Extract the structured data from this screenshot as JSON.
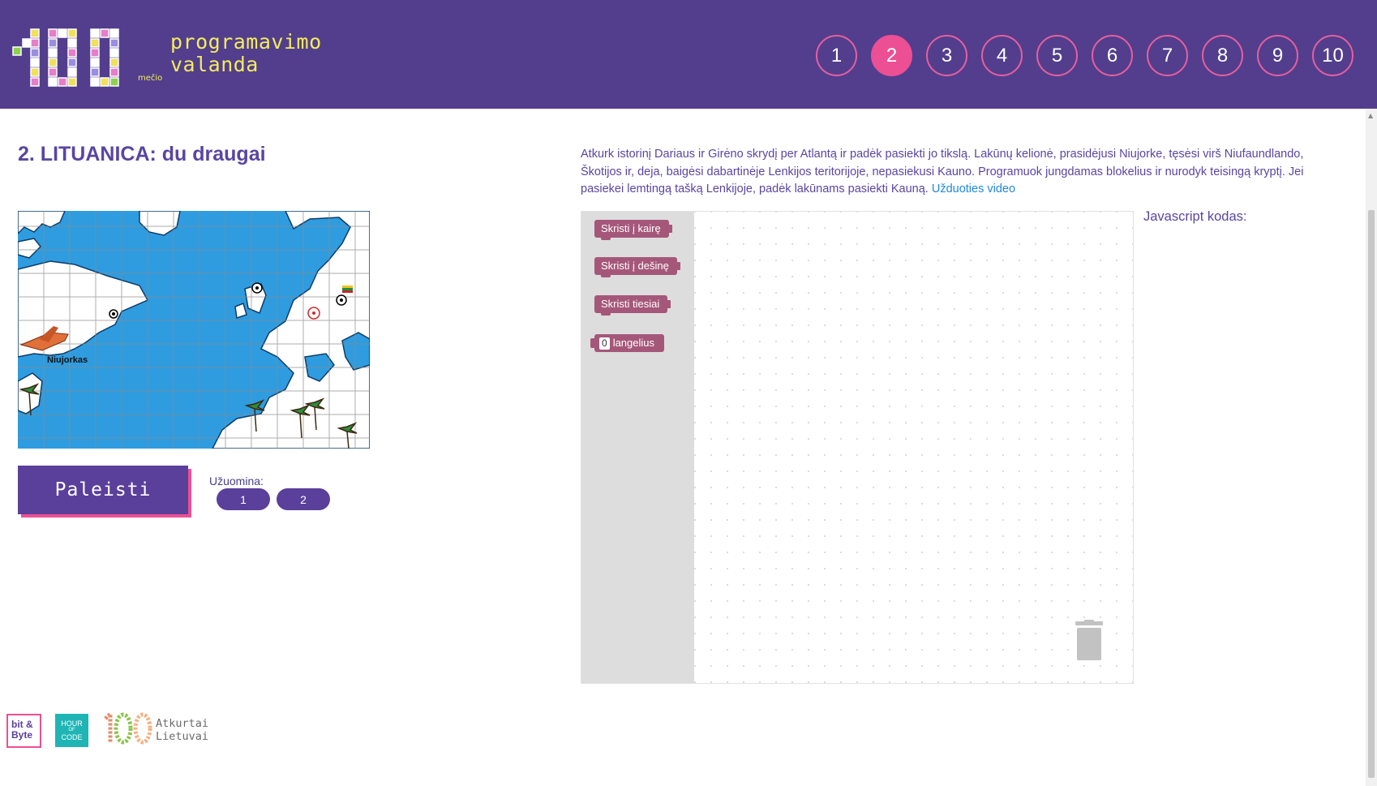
{
  "header": {
    "logo_main": "100",
    "logo_suffix": "mečio",
    "logo_line1": "programavimo",
    "logo_line2": "valanda",
    "levels": [
      "1",
      "2",
      "3",
      "4",
      "5",
      "6",
      "7",
      "8",
      "9",
      "10"
    ],
    "active_level": "2",
    "bg_color": "#523e8d",
    "accent_color": "#ec4f93"
  },
  "main": {
    "title": "2. LITUANICA: du draugai",
    "description": "Atkurk istorinį Dariaus ir Girėno skrydį per Atlantą ir padėk pasiekti jo tikslą. Lakūnų kelionė, prasidėjusi Niujorke, tęsėsi virš Niufaundlando, Škotijos ir, deja, baigėsi dabartinėje Lenkijos teritorijoje, nepasiekusi Kauno. Programuok jungdamas blokelius ir nurodyk teisingą kryptį. Jei pasiekei lemtingą tašką Lenkijoje, padėk lakūnams pasiekti Kauną.",
    "video_link": "Užduoties video"
  },
  "map": {
    "city_label": "Niujorkas",
    "icons": [
      "plane-icon",
      "palm-tree-icon",
      "target-icon",
      "flag-icon"
    ]
  },
  "controls": {
    "run_label": "Paleisti",
    "hint_label": "Užuomina:",
    "hints": [
      "1",
      "2"
    ]
  },
  "toolbox": {
    "blocks": [
      "Skristi į kairę",
      "Skristi į dešinę",
      "Skristi tiesiai"
    ],
    "number_value": "0",
    "number_unit": "langelius"
  },
  "code_panel": {
    "label": "Javascript kodas:"
  },
  "footer": {
    "bitbyte_line1": "bit &",
    "bitbyte_line2": "Byte",
    "hoc_line1": "HOUR",
    "hoc_line2": "OF",
    "hoc_line3": "CODE",
    "anniv_num": "100",
    "anniv_line1": "Atkurtai",
    "anniv_line2": "Lietuvai"
  }
}
